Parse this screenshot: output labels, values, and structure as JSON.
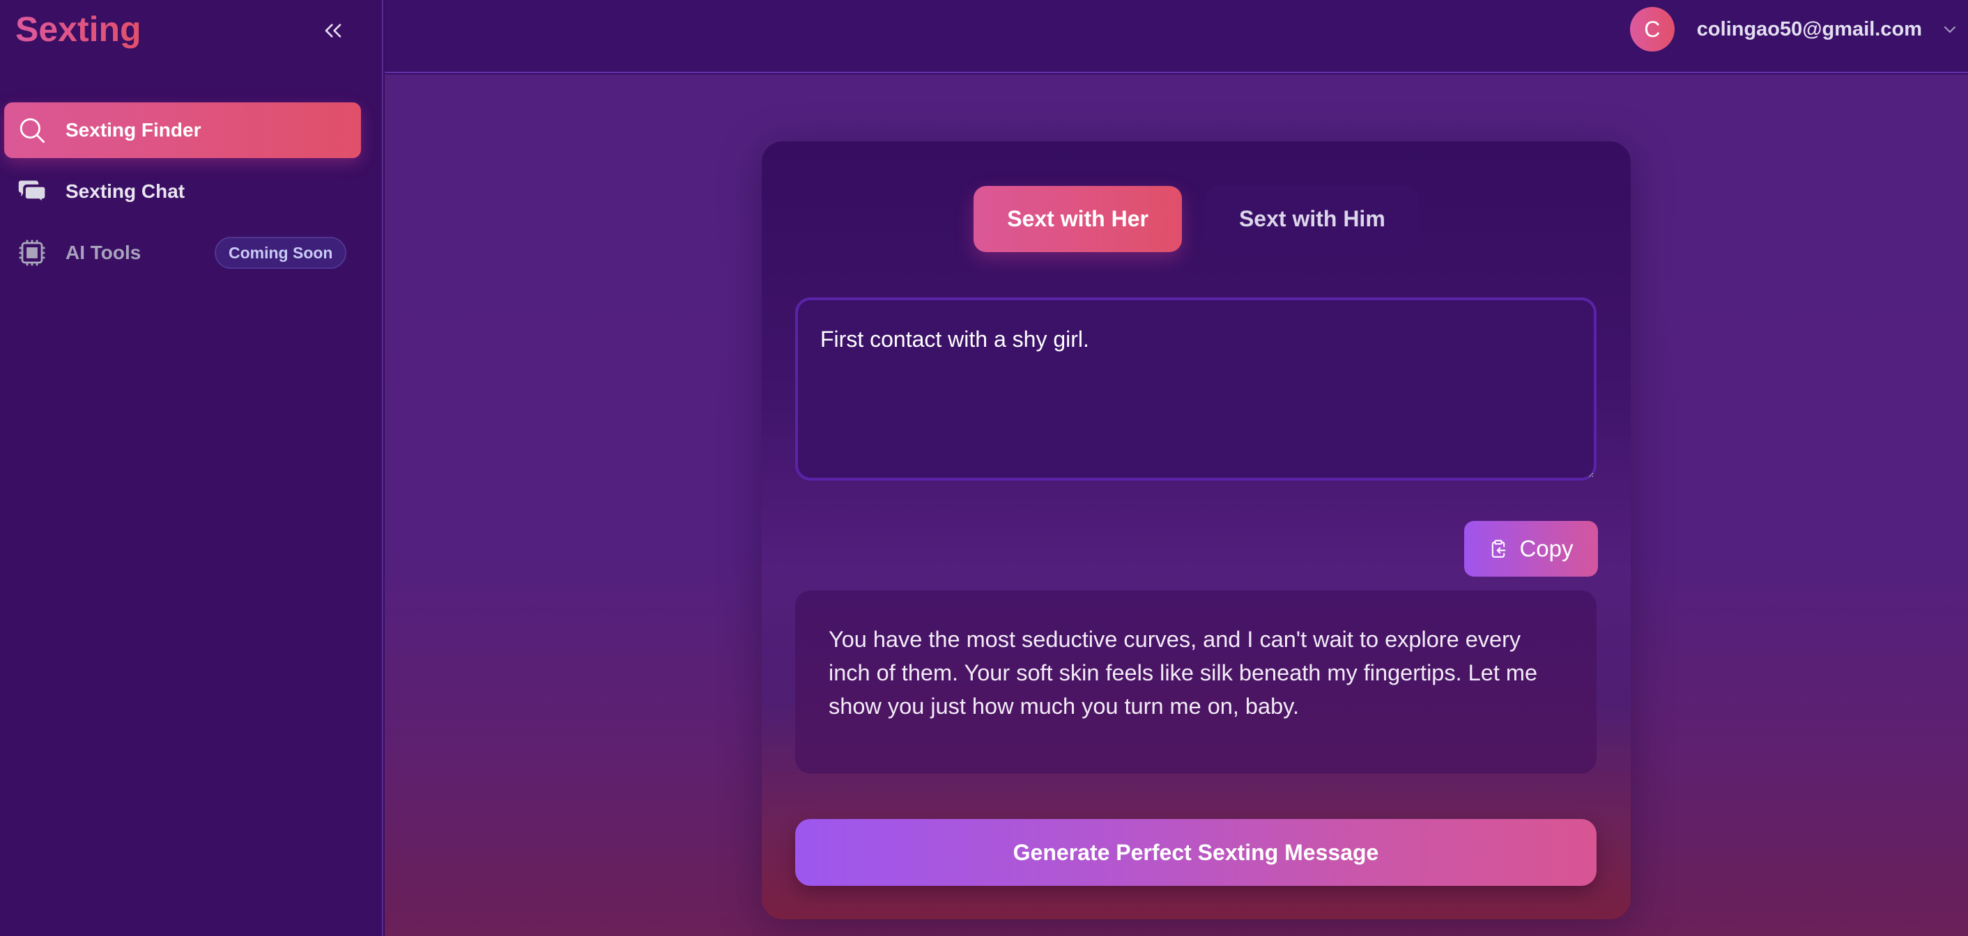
{
  "sidebar": {
    "logo": "Sexting",
    "collapse_icon": "chevrons-left-icon",
    "items": [
      {
        "label": "Sexting Finder",
        "icon": "search-icon",
        "active": true
      },
      {
        "label": "Sexting Chat",
        "icon": "chat-bubbles-icon",
        "active": false
      },
      {
        "label": "AI Tools",
        "icon": "chip-icon",
        "active": false,
        "badge": "Coming Soon"
      }
    ]
  },
  "header": {
    "avatar_initial": "C",
    "email": "colingao50@gmail.com",
    "dropdown_icon": "chevron-down-icon"
  },
  "main": {
    "tabs": [
      {
        "label": "Sext with Her",
        "active": true
      },
      {
        "label": "Sext with Him",
        "active": false
      }
    ],
    "prompt": {
      "value": "First contact with a shy girl."
    },
    "copy_button": {
      "label": "Copy",
      "icon": "clipboard-icon"
    },
    "result_text": "You have the most seductive curves, and I can't wait to explore every inch of them. Your soft skin feels like silk beneath my fingertips. Let me show you just how much you turn me on, baby.",
    "generate_button": {
      "label": "Generate Perfect Sexting Message"
    }
  },
  "colors": {
    "accent_pink": "#db5897",
    "accent_red": "#e1506a",
    "accent_purple": "#9d57ee",
    "sidebar_bg": "#3a0e62",
    "main_bg": "#52217f"
  }
}
